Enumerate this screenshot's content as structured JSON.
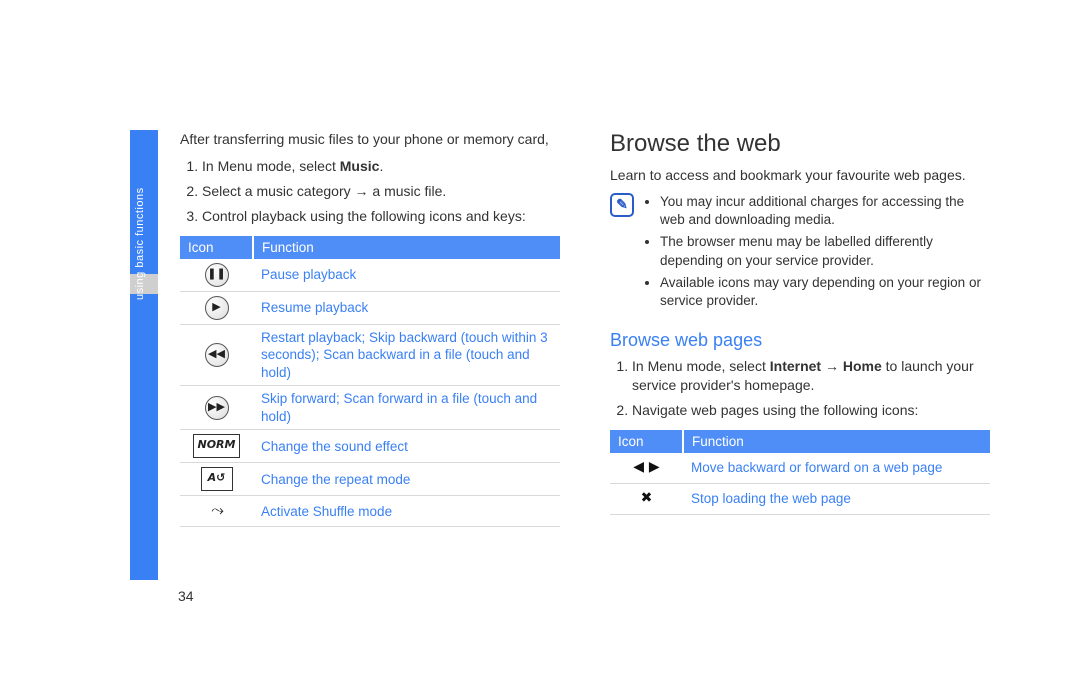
{
  "side_label": "using basic functions",
  "page_number": "34",
  "left": {
    "intro": "After transferring music files to your phone or memory card,",
    "steps": [
      {
        "pre": "In Menu mode, select ",
        "bold": "Music",
        "post": "."
      },
      {
        "full": "Select a music category → a music file."
      },
      {
        "full": "Control playback using the following icons and keys:"
      }
    ],
    "table": {
      "head_icon": "Icon",
      "head_func": "Function",
      "rows": [
        {
          "icon_type": "round",
          "glyph": "❚❚",
          "func": "Pause playback"
        },
        {
          "icon_type": "round",
          "glyph": "▶",
          "func": "Resume playback"
        },
        {
          "icon_type": "round",
          "glyph": "◀◀",
          "func": "Restart playback; Skip backward (touch within 3 seconds); Scan backward in a file (touch and hold)"
        },
        {
          "icon_type": "round",
          "glyph": "▶▶",
          "func": "Skip forward; Scan forward in a file (touch and hold)"
        },
        {
          "icon_type": "box",
          "glyph": "NORM",
          "func": "Change the sound effect"
        },
        {
          "icon_type": "box",
          "glyph": "A↺",
          "func": "Change the repeat mode"
        },
        {
          "icon_type": "shuffle",
          "glyph": "↝",
          "func": "Activate Shuffle mode"
        }
      ]
    }
  },
  "right": {
    "h1": "Browse the web",
    "intro": "Learn to access and bookmark your favourite web pages.",
    "note_glyph": "✎",
    "notes": [
      "You may incur additional charges for accessing the web and downloading media.",
      "The browser menu may be labelled differently depending on your service provider.",
      "Available icons may vary depending on your region or service provider."
    ],
    "h2": "Browse web pages",
    "steps": [
      {
        "pre": "In Menu mode, select ",
        "bold1": "Internet",
        "mid": " → ",
        "bold2": "Home",
        "post": " to launch your service provider's homepage."
      },
      {
        "full": "Navigate web pages using the following icons:"
      }
    ],
    "table": {
      "head_icon": "Icon",
      "head_func": "Function",
      "rows": [
        {
          "icon_type": "plain",
          "glyph": "◀ ▶",
          "func": "Move backward or forward on a web page"
        },
        {
          "icon_type": "plain",
          "glyph": "✖",
          "func": "Stop loading the web page"
        }
      ]
    }
  }
}
